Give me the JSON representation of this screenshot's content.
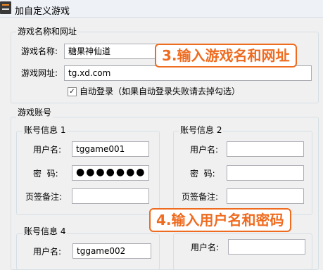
{
  "window": {
    "title": "加自定义游戏"
  },
  "game_info": {
    "legend": "游戏名称和网址",
    "name_label": "游戏名称:",
    "name_value": "糖果神仙道",
    "url_label": "游戏网址:",
    "url_value": "tg.xd.com",
    "autologin_checked": true,
    "autologin_checkmark": "✓",
    "autologin_label": "自动登录（如果自动登录失败请去掉勾选）"
  },
  "accounts": {
    "legend": "游戏账号",
    "account1": {
      "title": "账号信息 1",
      "username_label": "用户名:",
      "username_value": "tggame001",
      "password_label": "密  码:",
      "password_value": "●●●●●●●",
      "note_label": "页签备注:",
      "note_value": ""
    },
    "account2": {
      "title": "账号信息 2",
      "username_label": "用户名:",
      "username_value": "",
      "password_label": "密  码:",
      "password_value": "",
      "note_label": "页签备注:",
      "note_value": ""
    },
    "account4": {
      "title": "账号信息 4",
      "username_label": "用户名:",
      "username_value": "tggame002"
    },
    "account5": {
      "username_label": "用户名:",
      "username_value": ""
    }
  },
  "callouts": {
    "step3": "3.输入游戏名和网址",
    "step4": "4.输入用户名和密码"
  },
  "colors": {
    "callout": "#ef6b1f",
    "group_border": "#d5dfe5"
  }
}
